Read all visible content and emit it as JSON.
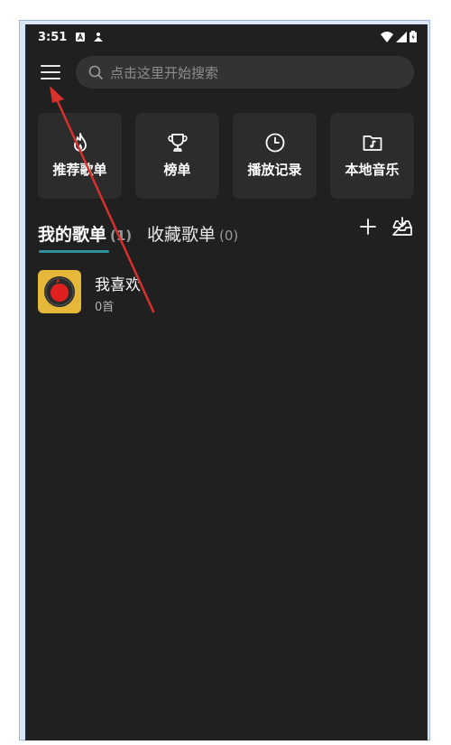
{
  "status_bar": {
    "time": "3:51"
  },
  "search": {
    "placeholder": "点击这里开始搜索"
  },
  "tiles": [
    {
      "label": "推荐歌单",
      "icon": "fire-icon"
    },
    {
      "label": "榜单",
      "icon": "trophy-icon"
    },
    {
      "label": "播放记录",
      "icon": "clock-icon"
    },
    {
      "label": "本地音乐",
      "icon": "music-folder-icon"
    }
  ],
  "tabs": {
    "my_playlists": {
      "label": "我的歌单",
      "count": "(1)"
    },
    "favorite_playlists": {
      "label": "收藏歌单",
      "count": "(0)"
    }
  },
  "playlists": [
    {
      "title": "我喜欢",
      "count": "0首"
    }
  ],
  "colors": {
    "background": "#202020",
    "tile_bg": "#2c2c2c",
    "accent_underline": "#2f8f9d",
    "cover_bg": "#e5b83a",
    "annotation_arrow": "#d9302c"
  }
}
